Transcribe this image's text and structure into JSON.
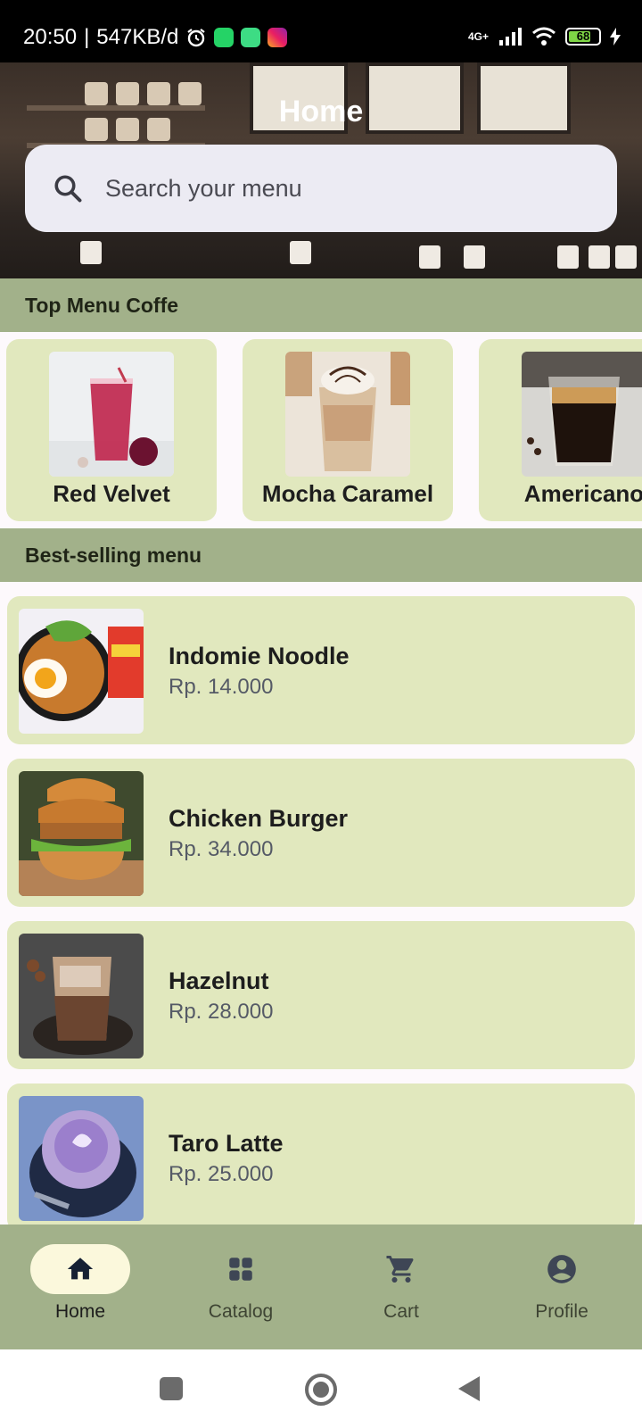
{
  "status_bar": {
    "time": "20:50",
    "speed": "547KB/d",
    "network": "4G+",
    "battery": "68",
    "icons": [
      "alarm-icon",
      "whatsapp-icon",
      "android-icon",
      "instagram-icon",
      "signal-icon",
      "wifi-icon",
      "battery-icon",
      "charging-icon"
    ]
  },
  "header": {
    "title": "Home"
  },
  "search": {
    "placeholder": "Search your menu"
  },
  "sections": {
    "top_menu": "Top Menu Coffe",
    "best_selling": "Best-selling menu"
  },
  "top_menu": [
    {
      "name": "Red Velvet"
    },
    {
      "name": "Mocha Caramel"
    },
    {
      "name": "Americano"
    }
  ],
  "best_selling": [
    {
      "name": "Indomie Noodle",
      "price": "Rp. 14.000"
    },
    {
      "name": "Chicken Burger",
      "price": "Rp. 34.000"
    },
    {
      "name": "Hazelnut",
      "price": "Rp. 28.000"
    },
    {
      "name": "Taro Latte",
      "price": "Rp. 25.000"
    }
  ],
  "bottom_nav": {
    "items": [
      {
        "label": "Home",
        "icon": "home-icon",
        "active": true
      },
      {
        "label": "Catalog",
        "icon": "grid-icon",
        "active": false
      },
      {
        "label": "Cart",
        "icon": "cart-icon",
        "active": false
      },
      {
        "label": "Profile",
        "icon": "account-icon",
        "active": false
      }
    ]
  },
  "colors": {
    "section_bg": "#a2b18a",
    "card_bg": "#e1e8be",
    "search_bg": "#ecebf3",
    "active_pill": "#fbf8dc"
  }
}
